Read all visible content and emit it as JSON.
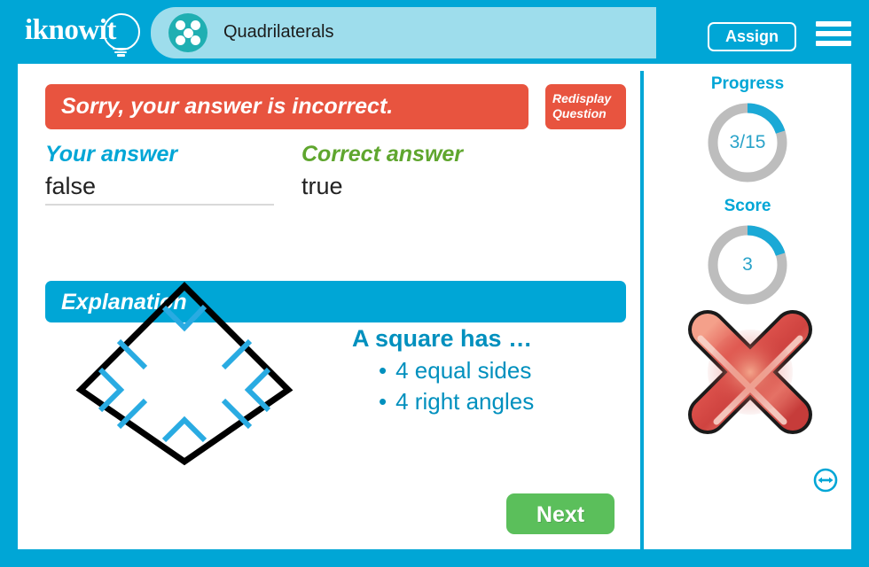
{
  "header": {
    "logo_text": "iknowit",
    "logo_icon": "lightbulb-icon",
    "badge_icon": "five-dot-circle-icon",
    "lesson_title": "Quadrilaterals",
    "assign_label": "Assign",
    "menu_icon": "hamburger-menu-icon"
  },
  "feedback": {
    "banner_text": "Sorry, your answer is incorrect.",
    "banner_color": "#E8543F",
    "redisplay_label": "Redisplay Question"
  },
  "answers": {
    "your_label": "Your answer",
    "your_value": "false",
    "correct_label": "Correct answer",
    "correct_value": "true",
    "your_label_color": "#00A6D6",
    "correct_label_color": "#5FA62E"
  },
  "explanation": {
    "heading": "Explanation",
    "heading_color": "#00A6D6",
    "figure_name": "square-diagram-rotated",
    "figure_outline_color": "#000000",
    "figure_mark_color": "#29ABE2",
    "facts_title": "A square has …",
    "facts": [
      "4 equal sides",
      "4 right angles"
    ],
    "facts_color": "#0090BE"
  },
  "actions": {
    "next_label": "Next",
    "next_color": "#5BBF5B"
  },
  "sidebar": {
    "progress_title": "Progress",
    "progress_value": "3/15",
    "progress_current": 3,
    "progress_total": 15,
    "progress_percent": 20,
    "score_title": "Score",
    "score_value": "3",
    "score_percent": 20,
    "gauge_fill_color": "#1BA9D6",
    "gauge_track_color": "#BDBDBD",
    "result_icon": "red-x-incorrect-icon",
    "resize_icon": "left-right-arrow-resize-icon"
  }
}
